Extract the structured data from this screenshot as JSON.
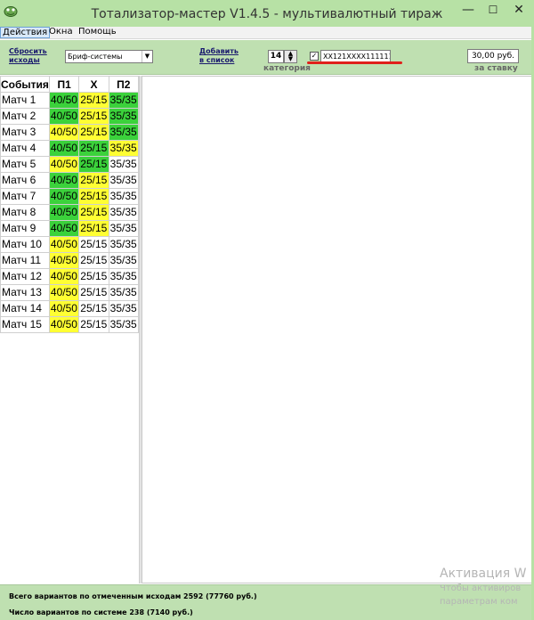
{
  "window": {
    "title": "Тотализатор-мастер V1.4.5 - мультивалютный тираж",
    "min_glyph": "—",
    "max_glyph": "☐",
    "close_glyph": "✕",
    "icon": "app-logo-icon"
  },
  "menu": [
    "Действия",
    "Окна",
    "Помощь"
  ],
  "toolbar": {
    "reset_line1": "Сбросить",
    "reset_line2": "исходы",
    "system_select": "Бриф-системы",
    "add_line1": "Добавить",
    "add_line2": "в список",
    "category_value": "14",
    "category_label": "категория",
    "checkbox_checked": true,
    "sequence": "XX121XXXX111111",
    "stake_value": "30,00 руб.",
    "stake_label": "за ставку"
  },
  "table": {
    "headers": [
      "События",
      "П1",
      "Х",
      "П2"
    ],
    "rows": [
      {
        "name": "Матч 1",
        "p1": "40/50",
        "x": "25/15",
        "p2": "35/35",
        "c": [
          "g",
          "y",
          "g"
        ]
      },
      {
        "name": "Матч 2",
        "p1": "40/50",
        "x": "25/15",
        "p2": "35/35",
        "c": [
          "g",
          "y",
          "g"
        ]
      },
      {
        "name": "Матч 3",
        "p1": "40/50",
        "x": "25/15",
        "p2": "35/35",
        "c": [
          "y",
          "y",
          "g"
        ]
      },
      {
        "name": "Матч 4",
        "p1": "40/50",
        "x": "25/15",
        "p2": "35/35",
        "c": [
          "g",
          "g",
          "y"
        ]
      },
      {
        "name": "Матч 5",
        "p1": "40/50",
        "x": "25/15",
        "p2": "35/35",
        "c": [
          "y",
          "g",
          "w"
        ]
      },
      {
        "name": "Матч 6",
        "p1": "40/50",
        "x": "25/15",
        "p2": "35/35",
        "c": [
          "g",
          "y",
          "w"
        ]
      },
      {
        "name": "Матч 7",
        "p1": "40/50",
        "x": "25/15",
        "p2": "35/35",
        "c": [
          "g",
          "y",
          "w"
        ]
      },
      {
        "name": "Матч 8",
        "p1": "40/50",
        "x": "25/15",
        "p2": "35/35",
        "c": [
          "g",
          "y",
          "w"
        ]
      },
      {
        "name": "Матч 9",
        "p1": "40/50",
        "x": "25/15",
        "p2": "35/35",
        "c": [
          "g",
          "y",
          "w"
        ]
      },
      {
        "name": "Матч 10",
        "p1": "40/50",
        "x": "25/15",
        "p2": "35/35",
        "c": [
          "y",
          "w",
          "w"
        ]
      },
      {
        "name": "Матч 11",
        "p1": "40/50",
        "x": "25/15",
        "p2": "35/35",
        "c": [
          "y",
          "w",
          "w"
        ]
      },
      {
        "name": "Матч 12",
        "p1": "40/50",
        "x": "25/15",
        "p2": "35/35",
        "c": [
          "y",
          "w",
          "w"
        ]
      },
      {
        "name": "Матч 13",
        "p1": "40/50",
        "x": "25/15",
        "p2": "35/35",
        "c": [
          "y",
          "w",
          "w"
        ]
      },
      {
        "name": "Матч 14",
        "p1": "40/50",
        "x": "25/15",
        "p2": "35/35",
        "c": [
          "y",
          "w",
          "w"
        ]
      },
      {
        "name": "Матч 15",
        "p1": "40/50",
        "x": "25/15",
        "p2": "35/35",
        "c": [
          "y",
          "w",
          "w"
        ]
      }
    ]
  },
  "watermark": {
    "line1": "Активация W",
    "line2": "Чтобы активиров",
    "line3": "параметрам ком"
  },
  "status": {
    "line1": "Всего вариантов по отмеченным исходам 2592 (77760 руб.)",
    "line2": "Число вариантов по системе 238 (7140 руб.)"
  },
  "colors": {
    "green_cell": "#3bd23b",
    "yellow_cell": "#ffff33",
    "window_green": "#b7e1a5",
    "highlight_underline": "#e0201b"
  }
}
